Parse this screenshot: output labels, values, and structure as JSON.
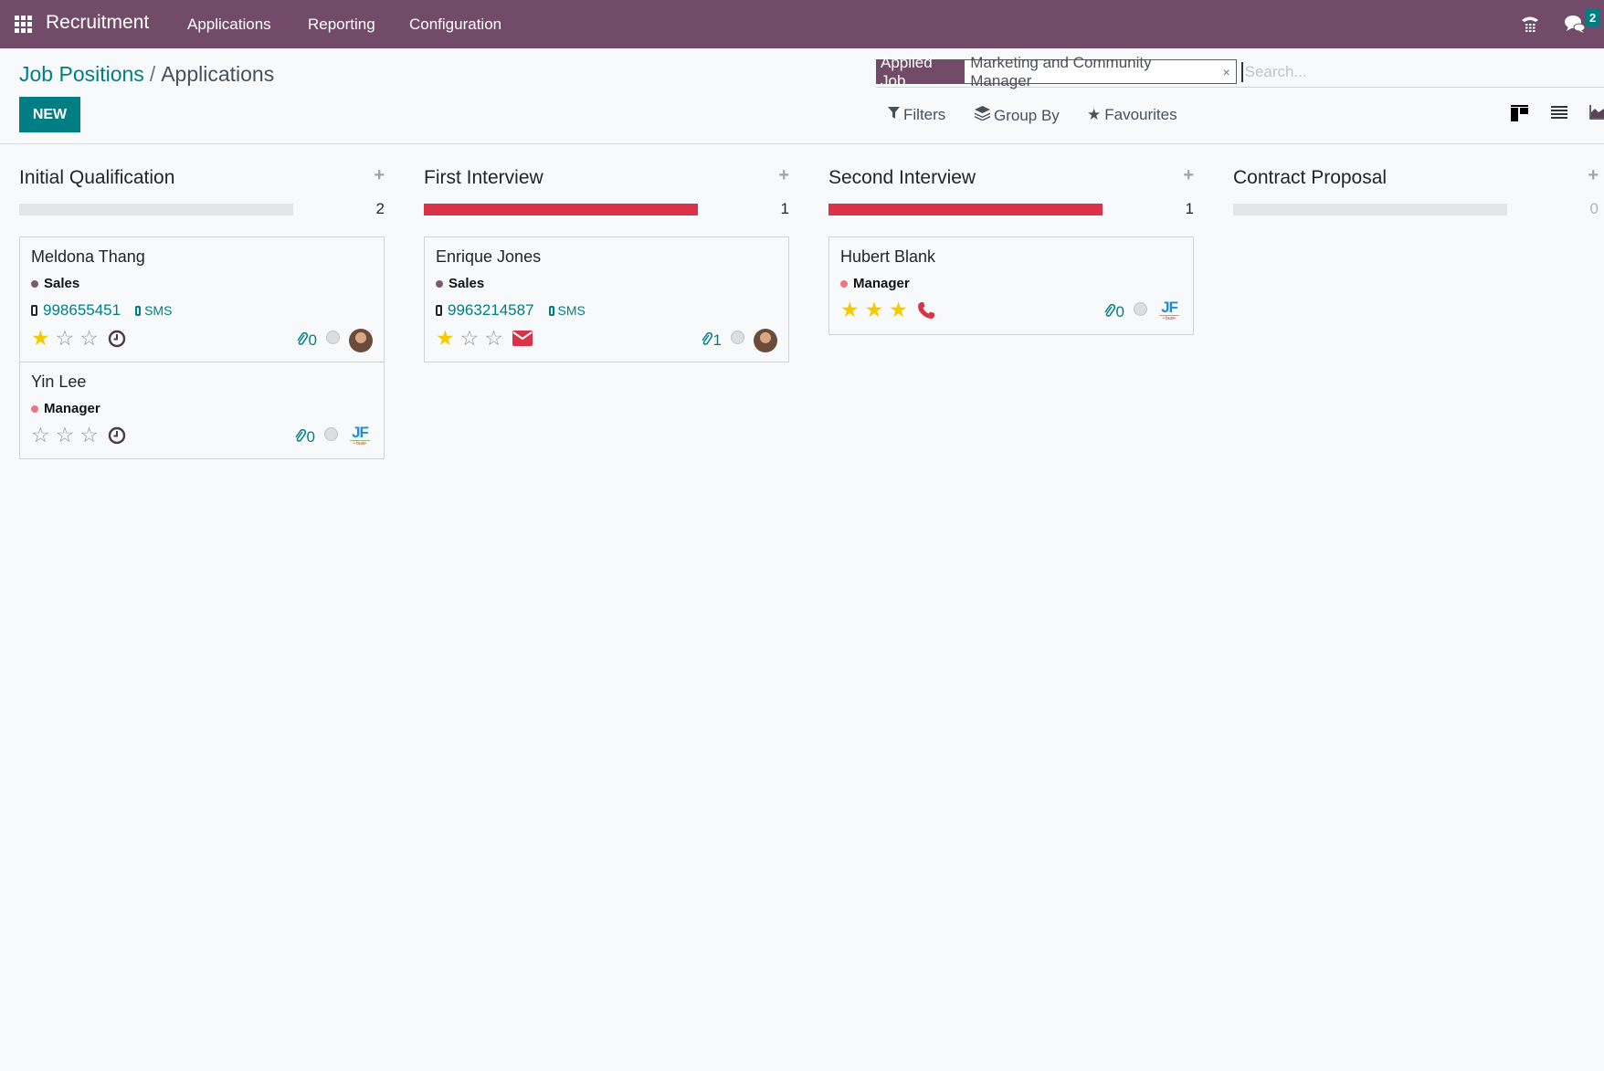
{
  "navbar": {
    "app_name": "Recruitment",
    "menu": [
      "Applications",
      "Reporting",
      "Configuration"
    ],
    "messages_badge": "2",
    "icons": [
      "apps-grid-icon",
      "phone-icon",
      "chat-icon"
    ]
  },
  "breadcrumb": {
    "parent": "Job Positions",
    "separator": "/",
    "current": "Applications"
  },
  "toolbar": {
    "new_label": "NEW"
  },
  "search": {
    "facet_label": "Applied Job",
    "facet_value": "Marketing and Community Manager",
    "facet_remove": "×",
    "placeholder": "Search..."
  },
  "filters": {
    "filters_label": "Filters",
    "group_by_label": "Group By",
    "favourites_label": "Favourites"
  },
  "views": [
    "kanban",
    "list",
    "graph"
  ],
  "colors": {
    "brand": "#714b67",
    "accent": "#017e84",
    "progress_red": "#d9334a",
    "star_yellow": "#f3cc00"
  },
  "columns": [
    {
      "title": "Initial Qualification",
      "add": "+",
      "count": "2",
      "progress": 0,
      "cards": [
        {
          "name": "Meldona Thang",
          "tag": "Sales",
          "tag_color": "#7c5873",
          "phone": "998655451",
          "sms": "SMS",
          "stars": 1,
          "activity": "clock",
          "attachments": "0",
          "avatar": "photo"
        },
        {
          "name": "Yin Lee",
          "tag": "Manager",
          "tag_color": "#e8787c",
          "phone": null,
          "sms": null,
          "stars": 0,
          "activity": "clock",
          "attachments": "0",
          "avatar": "logo"
        }
      ]
    },
    {
      "title": "First Interview",
      "add": "+",
      "count": "1",
      "progress": 1,
      "cards": [
        {
          "name": "Enrique Jones",
          "tag": "Sales",
          "tag_color": "#7c5873",
          "phone": "9963214587",
          "sms": "SMS",
          "stars": 1,
          "activity": "email",
          "attachments": "1",
          "avatar": "photo"
        }
      ]
    },
    {
      "title": "Second Interview",
      "add": "+",
      "count": "1",
      "progress": 1,
      "cards": [
        {
          "name": "Hubert Blank",
          "tag": "Manager",
          "tag_color": "#e8787c",
          "phone": null,
          "sms": null,
          "stars": 3,
          "activity": "call",
          "attachments": "0",
          "avatar": "logo"
        }
      ]
    },
    {
      "title": "Contract Proposal",
      "add": "+",
      "count": "0",
      "progress": 0,
      "cards": []
    }
  ],
  "logo_text": "JF",
  "logo_sub": "• busi•"
}
